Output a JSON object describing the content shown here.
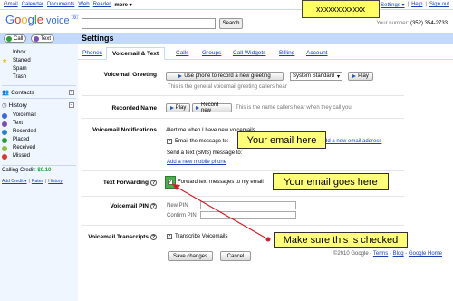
{
  "topnav": {
    "gmail": "Gmail",
    "calendar": "Calendar",
    "documents": "Documents",
    "web": "Web",
    "reader": "Reader",
    "more": "more ▾"
  },
  "user_redacted": "xxxxxxxxxxxx",
  "toplinks": {
    "settings": "Settings ▾",
    "sep1": "|",
    "help": "Help",
    "sep2": "|",
    "signout": "Sign out"
  },
  "logo": {
    "google": [
      "G",
      "o",
      "o",
      "g",
      "l",
      "e"
    ],
    "voice": "voice"
  },
  "search": {
    "button": "Search",
    "value": ""
  },
  "phone": {
    "label": "Your number:",
    "number": "(352) 354-2733"
  },
  "actions": {
    "call": "Call",
    "text": "Text"
  },
  "page_title": "Settings",
  "sidebar": {
    "inbox": "Inbox",
    "starred": "Starred",
    "spam": "Spam",
    "trash": "Trash",
    "contacts": "Contacts",
    "history": "History",
    "history_items": [
      "Voicemail",
      "Text",
      "Recorded",
      "Placed",
      "Received",
      "Missed"
    ],
    "credit_label": "Calling Credit:",
    "credit_value": "$0.10",
    "credit_links": {
      "add": "Add Credit ▾",
      "sep1": "|",
      "rates": "Rates",
      "sep2": "|",
      "history": "History"
    }
  },
  "tabs": [
    "Phones",
    "Voicemail & Text",
    "Calls",
    "Groups",
    "Call Widgets",
    "Billing",
    "Account"
  ],
  "greeting": {
    "label": "Voicemail Greeting",
    "record_btn": "Use phone to record a new greeting",
    "select": "System Standard",
    "play": "Play",
    "hint": "This is the general voicemail greeting callers hear"
  },
  "recorded_name": {
    "label": "Recorded Name",
    "play": "Play",
    "record": "Record new",
    "hint": "This is the name callers hear when they call you"
  },
  "notifications": {
    "label": "Voicemail Notifications",
    "alert": "Alert me when I have new voicemails",
    "email_check": "Email the message to:",
    "add_email": "Add a new email address",
    "sms": "Send a text (SMS) message to:",
    "add_phone": "Add a new mobile phone"
  },
  "forwarding": {
    "label": "Text Forwarding",
    "check_text": "Forward text messages to my email"
  },
  "pin": {
    "label": "Voicemail PIN",
    "new": "New PIN",
    "confirm": "Confirm PIN"
  },
  "transcripts": {
    "label": "Voicemail Transcripts",
    "check_text": "Transcribe Voicemails"
  },
  "buttons": {
    "save": "Save changes",
    "cancel": "Cancel"
  },
  "footer": {
    "copy": "©2010 Google -",
    "terms": "Terms",
    "sep1": "-",
    "blog": "Blog",
    "sep2": "-",
    "home": "Google Home"
  },
  "callouts": {
    "email": "Your email here",
    "forward": "Your email goes here",
    "checked": "Make sure this is checked"
  },
  "colors": {
    "bar": "#c3d9ff",
    "sidebar": "#f0f6ff",
    "callout": "#ffff7a",
    "arrow": "#cc1f2a",
    "link": "#1a3fb0"
  }
}
